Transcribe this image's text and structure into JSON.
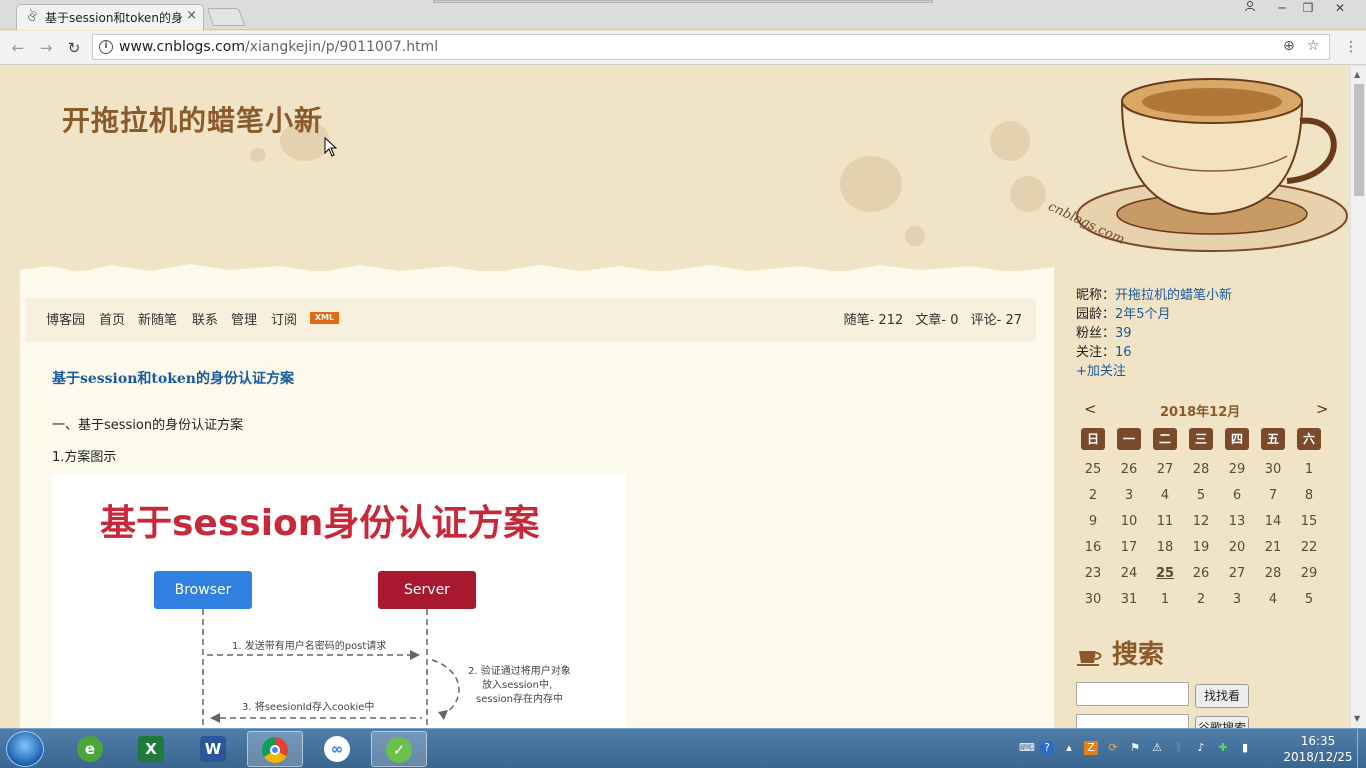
{
  "browser": {
    "tab_title": "基于session和token的身",
    "tab_close": "×",
    "url_host": "www.cnblogs.com",
    "url_path": "/xiangkejin/p/9011007.html",
    "back_icon": "←",
    "forward_icon": "→",
    "reload_icon": "↻",
    "zoom_icon": "⊕",
    "star_icon": "☆",
    "menu_icon": "⋮"
  },
  "blog": {
    "title": "开拖拉机的蜡笔小新",
    "watermark": "cnblogs.com"
  },
  "nav": {
    "items": [
      "博客园",
      "首页",
      "新随笔",
      "联系",
      "管理",
      "订阅"
    ],
    "xml_badge": "XML",
    "stats": [
      "随笔- 212",
      "文章- 0",
      "评论- 27"
    ]
  },
  "post": {
    "title": "基于session和token的身份认证方案",
    "para1": "一、基于session的身份认证方案",
    "para2": "1.方案图示",
    "figure": {
      "title": "基于session身份认证方案",
      "browser_label": "Browser",
      "server_label": "Server",
      "step1": "1. 发送带有用户名密码的post请求",
      "step2_line1": "2. 验证通过将用户对象",
      "step2_line2": "放入session中,",
      "step2_line3": "session存在内存中",
      "step3": "3. 将seesionId存入cookie中"
    }
  },
  "sidebar": {
    "nickname_label": "昵称：",
    "nickname": "开拖拉机的蜡笔小新",
    "age_label": "园龄：",
    "age": "2年5个月",
    "fans_label": "粉丝：",
    "fans": "39",
    "follow_label": "关注：",
    "follow": "16",
    "add_follow": "+加关注"
  },
  "calendar": {
    "prev": "<",
    "next": ">",
    "title": "2018年12月",
    "dow": [
      "日",
      "一",
      "二",
      "三",
      "四",
      "五",
      "六"
    ],
    "weeks": [
      [
        "25",
        "26",
        "27",
        "28",
        "29",
        "30",
        "1"
      ],
      [
        "2",
        "3",
        "4",
        "5",
        "6",
        "7",
        "8"
      ],
      [
        "9",
        "10",
        "11",
        "12",
        "13",
        "14",
        "15"
      ],
      [
        "16",
        "17",
        "18",
        "19",
        "20",
        "21",
        "22"
      ],
      [
        "23",
        "24",
        "25",
        "26",
        "27",
        "28",
        "29"
      ],
      [
        "30",
        "31",
        "1",
        "2",
        "3",
        "4",
        "5"
      ]
    ],
    "today": "25"
  },
  "search": {
    "title": "搜索",
    "button1": "找找看",
    "button2": "谷歌搜索"
  },
  "taskbar": {
    "time": "16:35",
    "date": "2018/12/25",
    "apps": [
      "ie",
      "excel",
      "word",
      "chrome",
      "baidu-netdisk",
      "app360"
    ]
  },
  "colors": {
    "accent_brown": "#8b5a2b",
    "link_blue": "#1a5a9a",
    "xml_orange": "#e06a10",
    "figure_red": "#c8283a",
    "browser_blue": "#2f80e0",
    "server_red": "#a8182e"
  }
}
